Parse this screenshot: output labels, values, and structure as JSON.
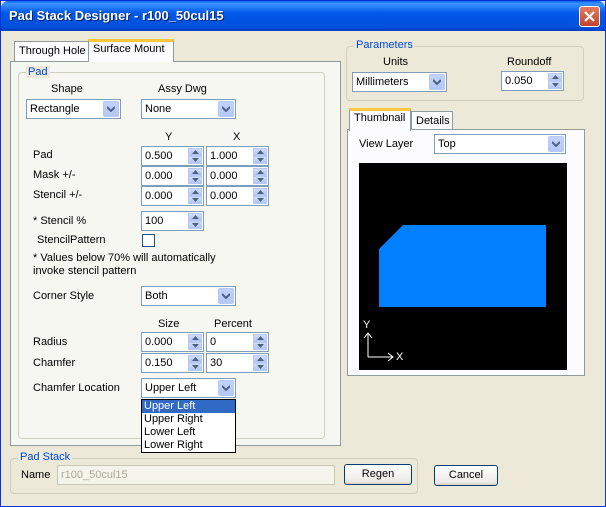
{
  "window": {
    "title": "Pad Stack Designer - r100_50cul15"
  },
  "tabs_left": [
    "Through Hole",
    "Surface Mount"
  ],
  "pad": {
    "group_title": "Pad",
    "shape_label": "Shape",
    "assy_label": "Assy Dwg",
    "shape_value": "Rectangle",
    "assy_value": "None",
    "y_header": "Y",
    "x_header": "X",
    "rows": [
      {
        "label": "Pad",
        "y": "0.500",
        "x": "1.000"
      },
      {
        "label": "Mask +/-",
        "y": "0.000",
        "x": "0.000"
      },
      {
        "label": "Stencil +/-",
        "y": "0.000",
        "x": "0.000"
      }
    ],
    "stencil_pct_label": "* Stencil %",
    "stencil_pct_value": "100",
    "stencil_pattern_label": "StencilPattern",
    "note_line1": "* Values below 70% will automatically",
    "note_line2": "invoke stencil pattern",
    "corner_style_label": "Corner Style",
    "corner_style_value": "Both",
    "size_header": "Size",
    "percent_header": "Percent",
    "radius_label": "Radius",
    "radius_size": "0.000",
    "radius_pct": "0",
    "chamfer_label": "Chamfer",
    "chamfer_size": "0.150",
    "chamfer_pct": "30",
    "chamfer_loc_label": "Chamfer Location",
    "chamfer_loc_value": "Upper Left",
    "chamfer_loc_options": [
      "Upper Left",
      "Upper Right",
      "Lower Left",
      "Lower Right"
    ]
  },
  "params": {
    "group_title": "Parameters",
    "units_label": "Units",
    "units_value": "Millimeters",
    "roundoff_label": "Roundoff",
    "roundoff_value": "0.050"
  },
  "tabs_right": [
    "Thumbnail",
    "Details"
  ],
  "view_layer": {
    "label": "View Layer",
    "value": "Top"
  },
  "thumbnail": {
    "axis_y": "Y",
    "axis_x": "X",
    "pad_color": "#0080ff"
  },
  "padstack": {
    "group_title": "Pad Stack",
    "name_label": "Name",
    "name_value": "r100_50cul15"
  },
  "buttons": {
    "regen": "Regen",
    "cancel": "Cancel"
  }
}
